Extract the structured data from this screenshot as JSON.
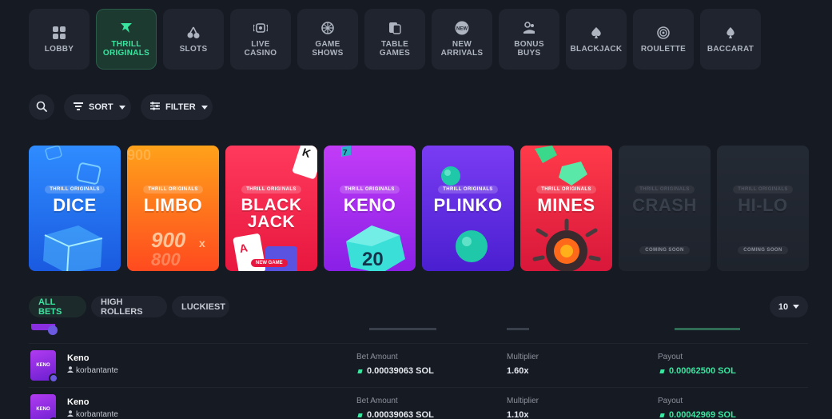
{
  "categories": [
    {
      "label": "LOBBY",
      "icon": "grid-icon",
      "active": false
    },
    {
      "label": "THRILL\nORIGINALS",
      "icon": "thrill-logo-icon",
      "active": true
    },
    {
      "label": "SLOTS",
      "icon": "cherries-icon",
      "active": false
    },
    {
      "label": "LIVE\nCASINO",
      "icon": "live-icon",
      "active": false
    },
    {
      "label": "GAME\nSHOWS",
      "icon": "wheel-icon",
      "active": false
    },
    {
      "label": "TABLE\nGAMES",
      "icon": "cards-icon",
      "active": false
    },
    {
      "label": "NEW\nARRIVALS",
      "icon": "new-badge-icon",
      "active": false
    },
    {
      "label": "BONUS\nBUYS",
      "icon": "bonus-icon",
      "active": false
    },
    {
      "label": "BLACKJACK",
      "icon": "spade-icon",
      "active": false
    },
    {
      "label": "ROULETTE",
      "icon": "roulette-icon",
      "active": false
    },
    {
      "label": "BACCARAT",
      "icon": "club-icon",
      "active": false
    }
  ],
  "toolbar": {
    "sort_label": "SORT",
    "filter_label": "FILTER"
  },
  "games": [
    {
      "badge": "THRILL ORIGINALS",
      "name": "DICE",
      "status": "",
      "color1": "#2f8cff",
      "color2": "#1a5ae0"
    },
    {
      "badge": "THRILL ORIGINALS",
      "name": "LIMBO",
      "status": "",
      "color1": "#ffa21a",
      "color2": "#ff4a1f",
      "art": "900x"
    },
    {
      "badge": "THRILL ORIGINALS",
      "name": "BLACK\nJACK",
      "status": "",
      "color1": "#ff3a5c",
      "color2": "#e8173f",
      "art_label": "NEW GAME"
    },
    {
      "badge": "THRILL ORIGINALS",
      "name": "KENO",
      "status": "",
      "color1": "#c23cf7",
      "color2": "#8a1fe6",
      "art": "20"
    },
    {
      "badge": "THRILL ORIGINALS",
      "name": "PLINKO",
      "status": "",
      "color1": "#7a3cf3",
      "color2": "#4a1fd0"
    },
    {
      "badge": "THRILL ORIGINALS",
      "name": "MINES",
      "status": "",
      "color1": "#ff3a4a",
      "color2": "#d8173a"
    },
    {
      "badge": "THRILL ORIGINALS",
      "name": "CRASH",
      "status": "COMING SOON",
      "color1": "#242a34",
      "color2": "#1e232c"
    },
    {
      "badge": "THRILL ORIGINALS",
      "name": "HI-LO",
      "status": "COMING SOON",
      "color1": "#242a34",
      "color2": "#1e232c"
    }
  ],
  "bet_tabs": [
    {
      "label": "ALL BETS",
      "active": true
    },
    {
      "label": "HIGH ROLLERS",
      "active": false
    },
    {
      "label": "LUCKIEST",
      "active": false
    }
  ],
  "rows_count": "10",
  "bet_columns": {
    "bet_amount": "Bet Amount",
    "multiplier": "Multiplier",
    "payout": "Payout"
  },
  "bets": [
    {
      "game": "Keno",
      "thumb": "KENO",
      "user": "korbantante",
      "bet": "0.00039063 SOL",
      "multiplier": "1.60x",
      "payout": "0.00062500 SOL"
    },
    {
      "game": "Keno",
      "thumb": "KENO",
      "user": "korbantante",
      "bet": "0.00039063 SOL",
      "multiplier": "1.10x",
      "payout": "0.00042969 SOL"
    }
  ]
}
